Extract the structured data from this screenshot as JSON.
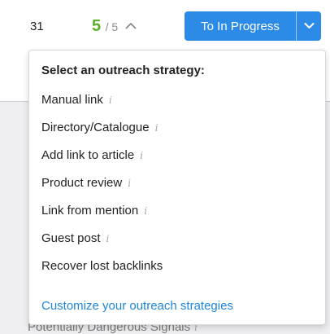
{
  "top_bar": {
    "count": "31",
    "score_value": "5",
    "score_total": "/ 5",
    "status_button_label": "To In Progress"
  },
  "menu": {
    "title": "Select an outreach strategy:",
    "items": [
      {
        "label": "Manual link",
        "info": "i"
      },
      {
        "label": "Directory/Catalogue",
        "info": "i"
      },
      {
        "label": "Add link to article",
        "info": "i"
      },
      {
        "label": "Product review",
        "info": "i"
      },
      {
        "label": "Link from mention",
        "info": "i"
      },
      {
        "label": "Guest post",
        "info": "i"
      },
      {
        "label": "Recover lost backlinks"
      }
    ],
    "customize_link": "Customize your outreach strategies"
  },
  "background": {
    "partial_text": "Potentially Dangerous Signals",
    "partial_info": "i"
  },
  "colors": {
    "accent_blue": "#2b8be6",
    "score_green": "#5aae2c",
    "link_blue": "#1f86dc"
  },
  "icons": {
    "score_toggle": "chevron-up-icon",
    "status_toggle": "chevron-down-icon",
    "info": "info-icon"
  }
}
